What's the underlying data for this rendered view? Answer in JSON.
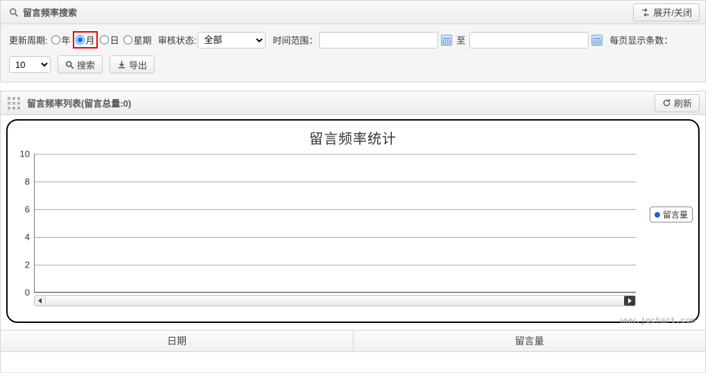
{
  "search_panel": {
    "title": "留言频率搜索",
    "toggle_label": "展开/关闭",
    "period_label": "更新周期:",
    "radios": {
      "year": "年",
      "month": "月",
      "day": "日",
      "week": "星期"
    },
    "audit_label": "审核状态:",
    "audit_select": {
      "selected": "全部",
      "options": [
        "全部"
      ]
    },
    "range_label": "时间范围：",
    "to_label": "至",
    "page_size_label": "每页显示条数：",
    "page_size_value": "10",
    "search_btn": "搜索",
    "export_btn": "导出"
  },
  "list_panel": {
    "title": "留言频率列表(留言总量:0)",
    "refresh_btn": "刷新"
  },
  "chart_data": {
    "type": "line",
    "title": "留言频率统计",
    "series": [
      {
        "name": "留言量",
        "values": []
      }
    ],
    "categories": [],
    "ylabel": "",
    "xlabel": "",
    "ylim": [
      0,
      10
    ],
    "yticks": [
      0,
      2,
      4,
      6,
      8,
      10
    ],
    "legend_position": "right",
    "grid": true
  },
  "watermark": "www.jqchart.com",
  "table": {
    "columns": [
      "日期",
      "留言量"
    ],
    "rows": []
  }
}
